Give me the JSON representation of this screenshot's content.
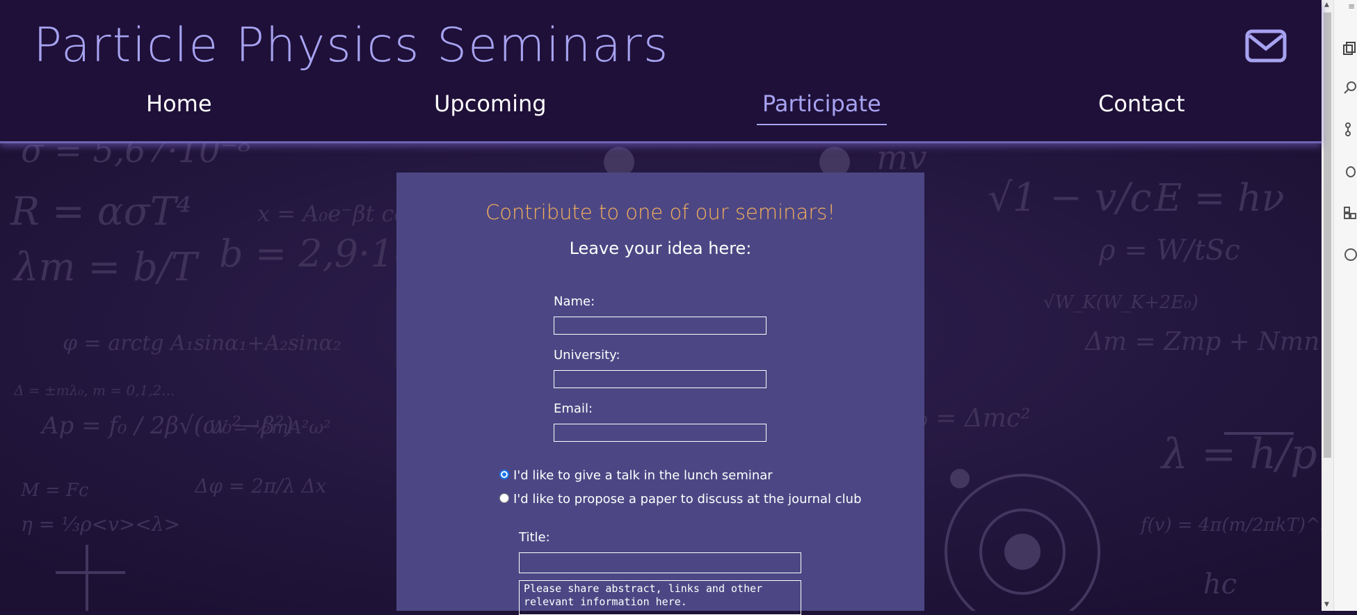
{
  "header": {
    "title": "Particle Physics Seminars",
    "mail_icon": "envelope-icon"
  },
  "nav": {
    "items": [
      {
        "label": "Home"
      },
      {
        "label": "Upcoming"
      },
      {
        "label": "Participate",
        "active": true
      },
      {
        "label": "Contact"
      }
    ]
  },
  "form": {
    "title": "Contribute to one of our seminars!",
    "subtitle": "Leave your idea here:",
    "name_label": "Name:",
    "name_value": "",
    "university_label": "University:",
    "university_value": "",
    "email_label": "Email:",
    "email_value": "",
    "radio_options": [
      {
        "label": "I'd like to give a talk in the lunch seminar",
        "checked": true
      },
      {
        "label": "I'd like to propose a paper to discuss at the journal club",
        "checked": false
      }
    ],
    "title_label": "Title:",
    "title_value": "",
    "details_placeholder": "Please share abstract, links and other relevant information here."
  },
  "colors": {
    "accent": "#a7a3f1",
    "card_title": "#f7b05b",
    "card_bg": "#4c4784",
    "page_bg": "#1f1039"
  }
}
